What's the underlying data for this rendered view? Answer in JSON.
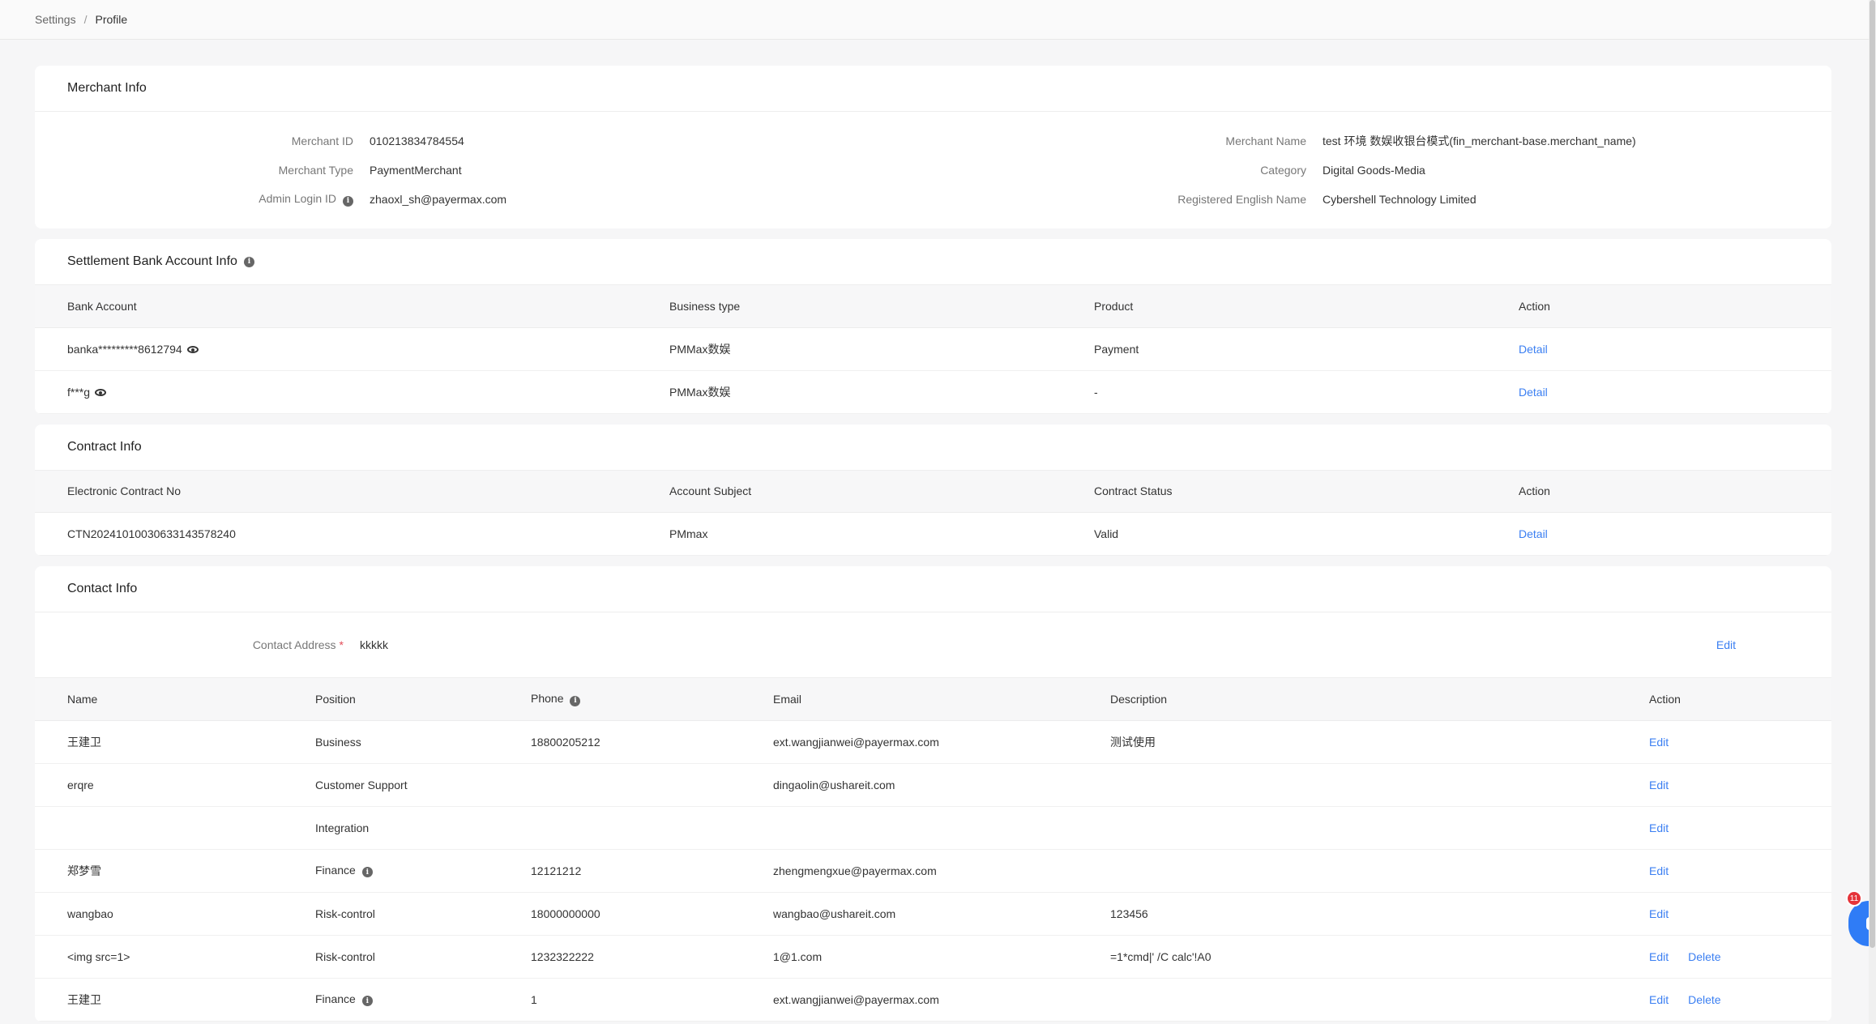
{
  "breadcrumb": {
    "parent": "Settings",
    "separator": "/",
    "current": "Profile"
  },
  "merchant_info": {
    "title": "Merchant Info",
    "left": [
      {
        "label": "Merchant ID",
        "value": "010213834784554"
      },
      {
        "label": "Merchant Type",
        "value": "PaymentMerchant"
      },
      {
        "label": "Admin Login ID",
        "value": "zhaoxl_sh@payermax.com"
      }
    ],
    "right": [
      {
        "label": "Merchant Name",
        "value": "test 环境 数娱收银台模式(fin_merchant-base.merchant_name)"
      },
      {
        "label": "Category",
        "value": "Digital Goods-Media"
      },
      {
        "label": "Registered English Name",
        "value": "Cybershell Technology Limited"
      }
    ]
  },
  "settlement": {
    "title": "Settlement Bank Account Info",
    "columns": [
      "Bank Account",
      "Business type",
      "Product",
      "Action"
    ],
    "rows": [
      {
        "account": "banka*********8612794",
        "business": "PMMax数娱",
        "product": "Payment",
        "action": "Detail"
      },
      {
        "account": "f***g",
        "business": "PMMax数娱",
        "product": "-",
        "action": "Detail"
      }
    ]
  },
  "contract": {
    "title": "Contract Info",
    "columns": [
      "Electronic Contract No",
      "Account Subject",
      "Contract Status",
      "Action"
    ],
    "rows": [
      {
        "no": "CTN20241010030633143578240",
        "subject": "PMmax",
        "status": "Valid",
        "action": "Detail"
      }
    ]
  },
  "contact": {
    "title": "Contact Info",
    "address_label": "Contact Address",
    "address_required": "*",
    "address_value": "kkkkk",
    "address_edit": "Edit",
    "columns": [
      "Name",
      "Position",
      "Phone",
      "Email",
      "Description",
      "Action"
    ],
    "rows": [
      {
        "name": "王建卫",
        "position": "Business",
        "phone": "18800205212",
        "email": "ext.wangjianwei@payermax.com",
        "description": "测试使用",
        "edit": "Edit",
        "delete": ""
      },
      {
        "name": "erqre",
        "position": "Customer Support",
        "phone": "",
        "email": "dingaolin@ushareit.com",
        "description": "",
        "edit": "Edit",
        "delete": ""
      },
      {
        "name": "",
        "position": "Integration",
        "phone": "",
        "email": "",
        "description": "",
        "edit": "Edit",
        "delete": ""
      },
      {
        "name": "郑梦雪",
        "position": "Finance",
        "phone": "12121212",
        "email": "zhengmengxue@payermax.com",
        "description": "",
        "edit": "Edit",
        "delete": ""
      },
      {
        "name": "wangbao",
        "position": "Risk-control",
        "phone": "18000000000",
        "email": "wangbao@ushareit.com",
        "description": "123456",
        "edit": "Edit",
        "delete": ""
      },
      {
        "name": "<img src=1>",
        "position": "Risk-control",
        "phone": "1232322222",
        "email": "1@1.com",
        "description": "=1*cmd|' /C calc'!A0",
        "edit": "Edit",
        "delete": "Delete"
      },
      {
        "name": "王建卫",
        "position": "Finance",
        "phone": "1",
        "email": "ext.wangjianwei@payermax.com",
        "description": "",
        "edit": "Edit",
        "delete": "Delete"
      }
    ]
  },
  "chat": {
    "badge": "11"
  },
  "colors": {
    "link": "#3b7ff2",
    "chat": "#2f7cf6",
    "badge": "#e5343a"
  }
}
